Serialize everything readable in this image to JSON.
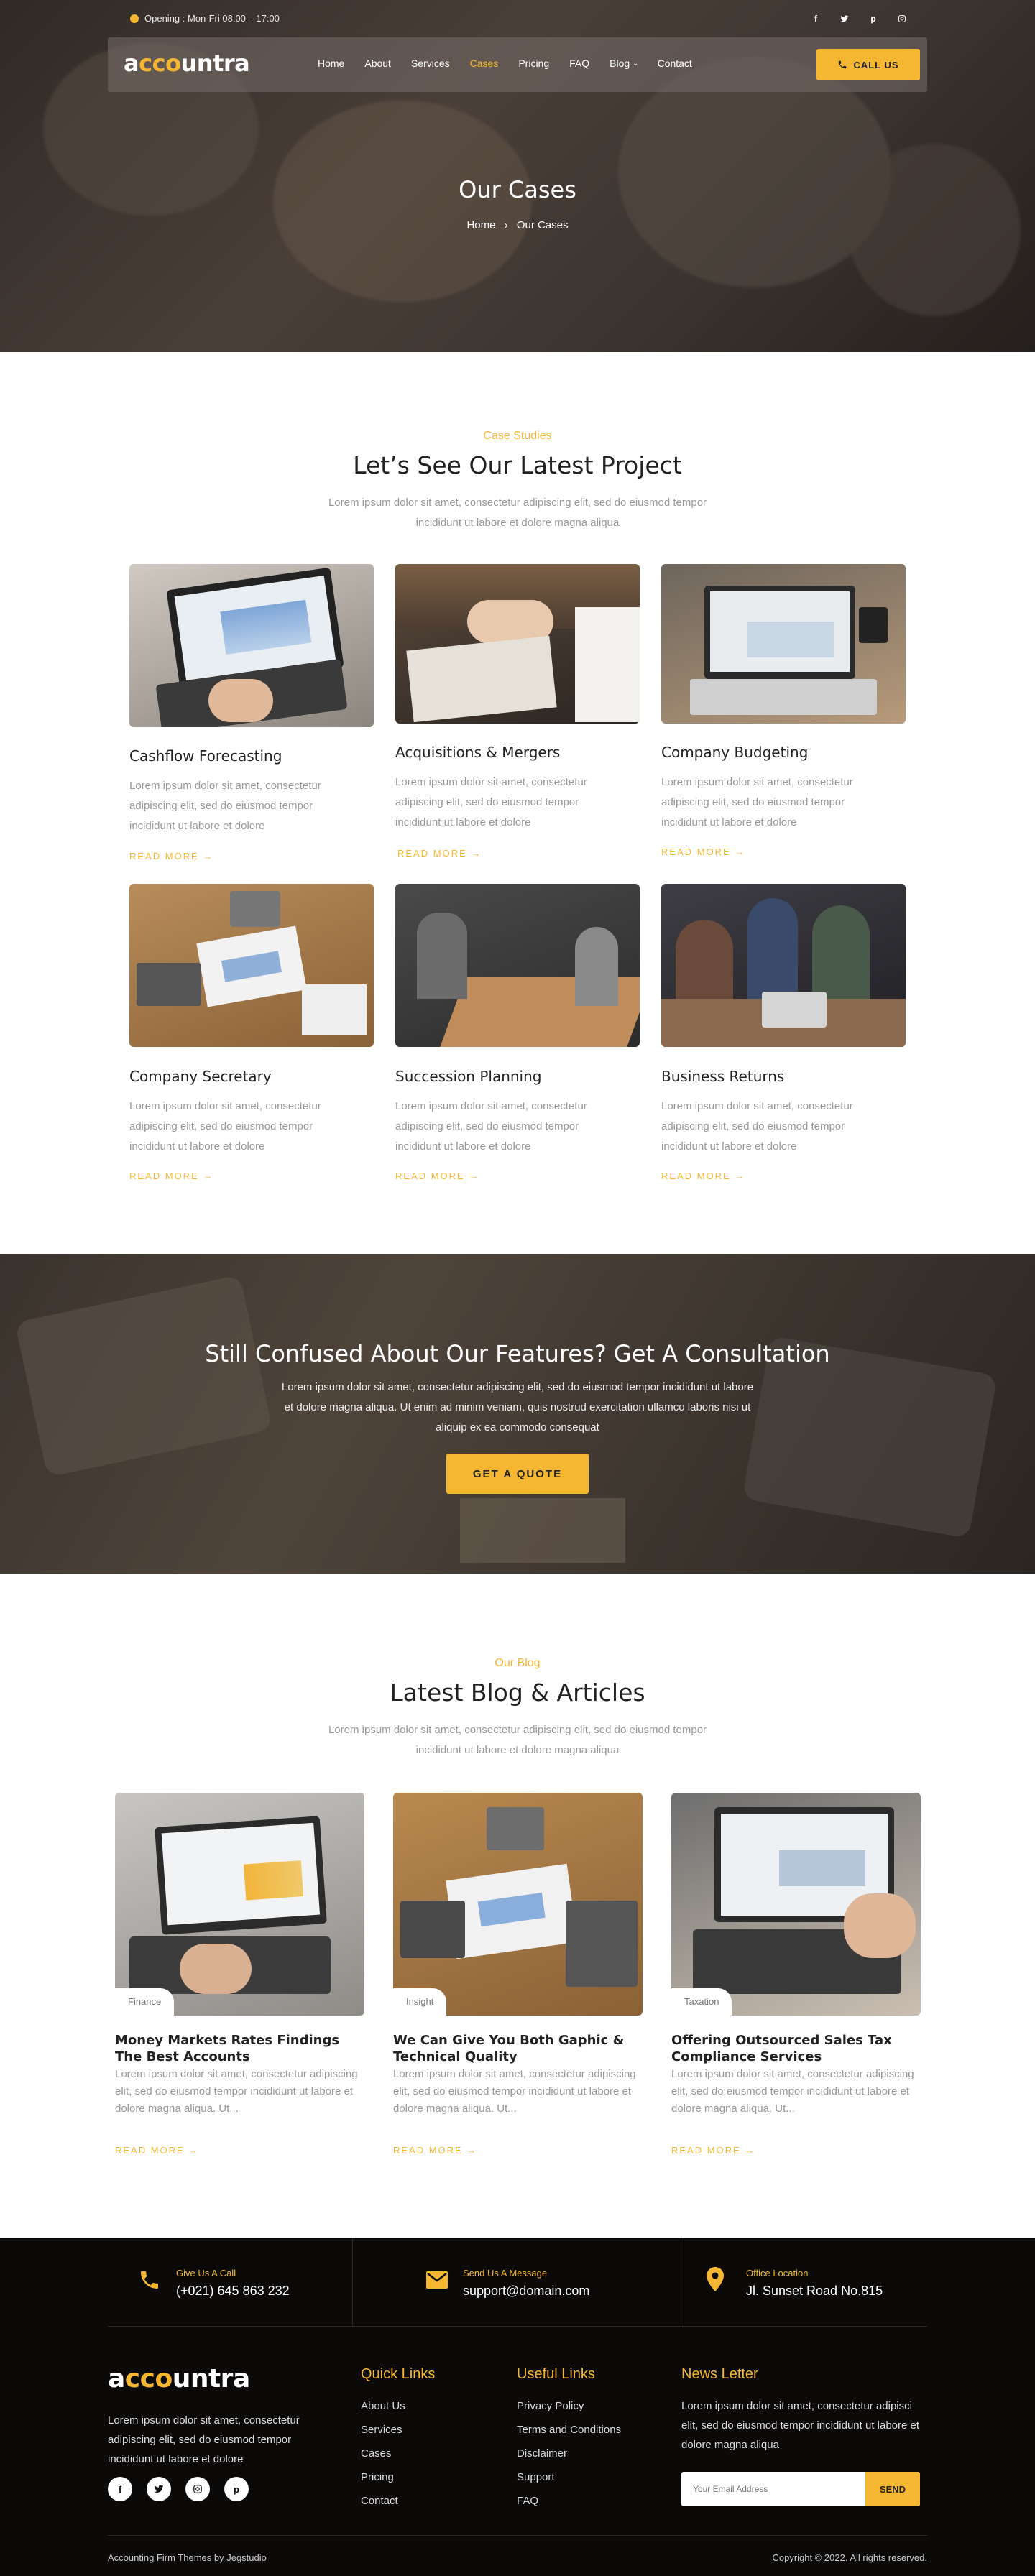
{
  "topbar": {
    "opening": "Opening : Mon-Fri 08:00 – 17:00",
    "social": [
      "f",
      "t",
      "p",
      "ig"
    ]
  },
  "brand": {
    "logo_pre": "a",
    "logo_oo": "cco",
    "logo_post": "untra",
    "accent": "#f5b731"
  },
  "nav": {
    "items": [
      "Home",
      "About",
      "Services",
      "Cases",
      "Pricing",
      "FAQ",
      "Blog",
      "Contact"
    ],
    "active": "Cases",
    "call_label": "CALL US"
  },
  "hero": {
    "title": "Our Cases",
    "crumb_home": "Home",
    "crumb_sep": "›",
    "crumb_current": "Our Cases"
  },
  "cases": {
    "eyebrow": "Case Studies",
    "title": "Let’s See Our Latest Project",
    "desc": "Lorem ipsum dolor sit amet, consectetur adipiscing elit, sed do eiusmod tempor incididunt ut labore et dolore magna aliqua",
    "items": [
      {
        "title": "Cashflow Forecasting",
        "desc": "Lorem ipsum dolor sit amet, consectetur adipiscing elit, sed do eiusmod tempor incididunt ut labore et dolore",
        "link": "READ MORE"
      },
      {
        "title": "Acquisitions & Mergers",
        "desc": "Lorem ipsum dolor sit amet, consectetur adipiscing elit, sed do eiusmod tempor incididunt ut labore et dolore",
        "link": "READ MORE"
      },
      {
        "title": "Company Budgeting",
        "desc": "Lorem ipsum dolor sit amet, consectetur adipiscing elit, sed do eiusmod tempor incididunt ut labore et dolore",
        "link": "READ MORE"
      },
      {
        "title": "Company Secretary",
        "desc": "Lorem ipsum dolor sit amet, consectetur adipiscing elit, sed do eiusmod tempor incididunt ut labore et dolore",
        "link": "READ MORE"
      },
      {
        "title": "Succession Planning",
        "desc": "Lorem ipsum dolor sit amet, consectetur adipiscing elit, sed do eiusmod tempor incididunt ut labore et dolore",
        "link": "READ MORE"
      },
      {
        "title": "Business Returns",
        "desc": "Lorem ipsum dolor sit amet, consectetur adipiscing elit, sed do eiusmod tempor incididunt ut labore et dolore",
        "link": "READ MORE"
      }
    ]
  },
  "cta": {
    "title": "Still Confused About Our Features? Get A Consultation",
    "desc": "Lorem ipsum dolor sit amet, consectetur adipiscing elit, sed do eiusmod tempor incididunt ut labore et dolore magna aliqua. Ut enim ad minim veniam, quis nostrud exercitation ullamco laboris nisi ut aliquip ex ea commodo consequat",
    "button": "GET A QUOTE"
  },
  "blog": {
    "eyebrow": "Our Blog",
    "title": "Latest Blog & Articles",
    "desc": "Lorem ipsum dolor sit amet, consectetur adipiscing elit, sed do eiusmod tempor incididunt ut labore et dolore magna aliqua",
    "posts": [
      {
        "tag": "Finance",
        "title": "Money Markets Rates Findings The Best Accounts",
        "desc": "Lorem ipsum dolor sit amet, consectetur adipiscing elit, sed do eiusmod tempor incididunt ut labore et dolore magna aliqua. Ut...",
        "link": "READ MORE"
      },
      {
        "tag": "Insight",
        "title": "We Can Give You Both Gaphic & Technical Quality",
        "desc": "Lorem ipsum dolor sit amet, consectetur adipiscing elit, sed do eiusmod tempor incididunt ut labore et dolore magna aliqua. Ut...",
        "link": "READ MORE"
      },
      {
        "tag": "Taxation",
        "title": "Offering Outsourced Sales Tax Compliance Services",
        "desc": "Lorem ipsum dolor sit amet, consectetur adipiscing elit, sed do eiusmod tempor incididunt ut labore et dolore magna aliqua. Ut...",
        "link": "READ MORE"
      }
    ]
  },
  "contact": {
    "call_label": "Give Us A Call",
    "call_value": "(+021) 645 863 232",
    "msg_label": "Send Us A Message",
    "msg_value": "support@domain.com",
    "office_label": "Office Location",
    "office_value": "Jl. Sunset Road No.815"
  },
  "footer": {
    "about": "Lorem ipsum dolor sit amet, consectetur adipiscing elit, sed do eiusmod tempor incididunt ut labore et dolore",
    "quick_title": "Quick Links",
    "quick_links": [
      "About Us",
      "Services",
      "Cases",
      "Pricing",
      "Contact"
    ],
    "useful_title": "Useful Links",
    "useful_links": [
      "Privacy Policy",
      "Terms and Conditions",
      "Disclaimer",
      "Support",
      "FAQ"
    ],
    "news_title": "News Letter",
    "news_text": "Lorem ipsum dolor sit amet, consectetur adipisci elit, sed do eiusmod tempor incididunt ut labore et dolore magna aliqua",
    "email_placeholder": "Your Email Address",
    "send_label": "SEND",
    "credit": "Accounting Firm Themes by Jegstudio",
    "copyright": "Copyright © 2022. All rights reserved."
  }
}
